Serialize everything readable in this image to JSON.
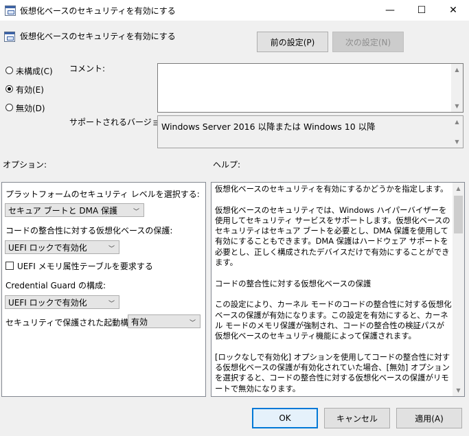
{
  "window": {
    "title": "仮想化ベースのセキュリティを有効にする",
    "minimize": "—",
    "maximize": "☐",
    "close": "✕"
  },
  "header": {
    "policy_name": "仮想化ベースのセキュリティを有効にする",
    "prev_button": "前の設定(P)",
    "next_button": "次の設定(N)"
  },
  "state_options": [
    {
      "label": "未構成(C)",
      "checked": false
    },
    {
      "label": "有効(E)",
      "checked": true
    },
    {
      "label": "無効(D)",
      "checked": false
    }
  ],
  "comment": {
    "label": "コメント:",
    "value": ""
  },
  "supported": {
    "label": "サポートされるバージョン:",
    "value": "Windows Server 2016 以降または Windows 10 以降"
  },
  "options_label": "オプション:",
  "help_label": "ヘルプ:",
  "options": {
    "platform_label": "プラットフォームのセキュリティ レベルを選択する:",
    "platform_value": "セキュア ブートと DMA 保護",
    "code_integrity_label": "コードの整合性に対する仮想化ベースの保護:",
    "code_integrity_value": "UEFI ロックで有効化",
    "uefi_memory_label": "UEFI メモリ属性テーブルを要求する",
    "credential_guard_label": "Credential  Guard の構成:",
    "credential_guard_value": "UEFI ロックで有効化",
    "secure_launch_label": "セキュリティで保護された起動構成:",
    "secure_launch_value": "有効"
  },
  "help_text": "仮想化ベースのセキュリティを有効にするかどうかを指定します。\n\n仮想化ベースのセキュリティでは、Windows ハイパーバイザーを使用してセキュリティ サービスをサポートします。仮想化ベースのセキュリティはセキュア ブートを必要とし、DMA 保護を使用して有効にすることもできます。DMA 保護はハードウェア サポートを必要とし、正しく構成されたデバイスだけで有効にすることができます。\n\nコードの整合性に対する仮想化ベースの保護\n\nこの設定により、カーネル モードのコードの整合性に対する仮想化ベースの保護が有効になります。この設定を有効にすると、カーネル モードのメモリ保護が強制され、コードの整合性の検証パスが仮想化ベースのセキュリティ機能によって保護されます。\n\n[ロックなしで有効化] オプションを使用してコードの整合性に対する仮想化ベースの保護が有効化されていた場合、[無効] オプションを選択すると、コードの整合性に対する仮想化ベースの保護がリモートで無効になります。\n\n[UEFI ロックで有効化] オプションを選択すると、コードの整合性に対する",
  "footer": {
    "ok": "OK",
    "cancel": "キャンセル",
    "apply": "適用(A)"
  }
}
